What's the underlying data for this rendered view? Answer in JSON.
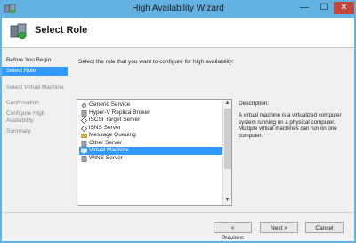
{
  "window": {
    "title": "High Availability Wizard",
    "minimize": "—",
    "maximize": "☐",
    "close": "✕"
  },
  "header": {
    "title": "Select Role"
  },
  "nav": {
    "items": [
      {
        "label": "Before You Begin",
        "state": "normal"
      },
      {
        "label": "Select Role",
        "state": "active"
      },
      {
        "label": "Select Virtual Machine",
        "state": "dim"
      },
      {
        "label": "Confirmation",
        "state": "dim"
      },
      {
        "label": "Configure High",
        "state": "dim"
      },
      {
        "label": "Availability",
        "state": "dim"
      },
      {
        "label": "Summary",
        "state": "dim"
      }
    ]
  },
  "main": {
    "prompt": "Select the role that you want to configure for high availability:",
    "roles": [
      {
        "label": "Generic Service",
        "icon": "gear-icon",
        "selected": false
      },
      {
        "label": "Hyper-V Replica Broker",
        "icon": "server-icon",
        "selected": false
      },
      {
        "label": "iSCSI Target Server",
        "icon": "diamond-icon",
        "selected": false
      },
      {
        "label": "iSNS Server",
        "icon": "diamond-icon",
        "selected": false
      },
      {
        "label": "Message Queuing",
        "icon": "envelope-icon",
        "selected": false
      },
      {
        "label": "Other Server",
        "icon": "server-icon",
        "selected": false
      },
      {
        "label": "Virtual Machine",
        "icon": "vm-icon",
        "selected": true
      },
      {
        "label": "WINS Server",
        "icon": "server-icon",
        "selected": false
      }
    ],
    "description_title": "Description:",
    "description": "A virtual machine is a virtualized computer system running on a physical computer. Multiple virtual machines can run on one computer."
  },
  "buttons": {
    "previous": "< Previous",
    "next": "Next >",
    "cancel": "Cancel"
  },
  "colors": {
    "titlebar": "#62b3e4",
    "selection": "#3399ff",
    "close_button": "#c7463b"
  }
}
